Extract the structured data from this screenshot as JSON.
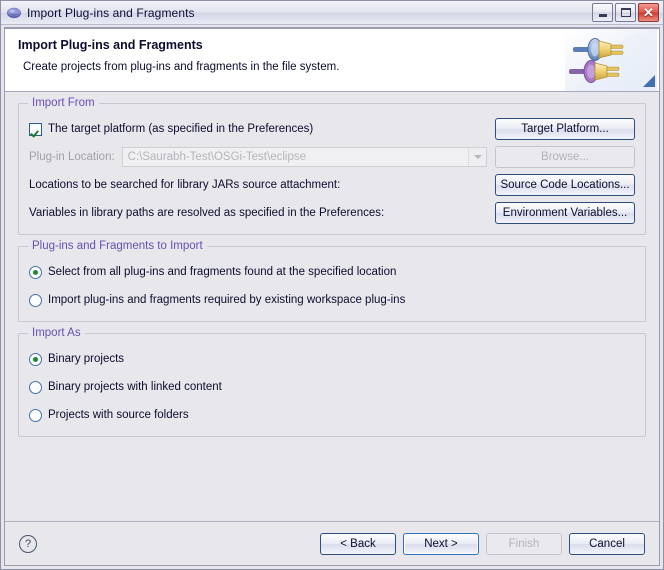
{
  "window": {
    "title": "Import Plug-ins and Fragments",
    "app_icon": "eclipse-icon",
    "controls": {
      "minimize": "minimize-icon",
      "maximize": "maximize-icon",
      "close": "close-icon"
    }
  },
  "header": {
    "title": "Import Plug-ins and Fragments",
    "description": "Create projects from plug-ins and fragments in the file system.",
    "graphic": "plug-connector-graphic"
  },
  "groups": {
    "import_from": {
      "title": "Import From",
      "target_platform_checkbox": {
        "label": "The target platform (as specified in the Preferences)",
        "checked": true
      },
      "plugin_location": {
        "label": "Plug-in Location:",
        "value": "C:\\Saurabh-Test\\OSGi-Test\\eclipse",
        "disabled": true
      },
      "source_attachment_label": "Locations to be searched for library JARs source attachment:",
      "variables_label": "Variables in library paths are resolved as specified in the Preferences:",
      "buttons": {
        "target_platform": "Target Platform...",
        "browse": "Browse...",
        "source_code_locations": "Source Code Locations...",
        "environment_variables": "Environment Variables..."
      }
    },
    "plugins_to_import": {
      "title": "Plug-ins and Fragments to Import",
      "options": [
        {
          "label": "Select from all plug-ins and fragments found at the specified location",
          "selected": true
        },
        {
          "label": "Import plug-ins and fragments required by existing workspace plug-ins",
          "selected": false
        }
      ]
    },
    "import_as": {
      "title": "Import As",
      "options": [
        {
          "label": "Binary projects",
          "selected": true
        },
        {
          "label": "Binary projects with linked content",
          "selected": false
        },
        {
          "label": "Projects with source folders",
          "selected": false
        }
      ]
    }
  },
  "footer": {
    "help": "help-icon",
    "buttons": {
      "back": "< Back",
      "next": "Next >",
      "finish": "Finish",
      "cancel": "Cancel"
    }
  },
  "colors": {
    "group_title": "#6a4fb5",
    "accent_button_border": "#2f6fc4",
    "radio_dot": "#1a8a33",
    "check_mark": "#1a7a2e"
  }
}
